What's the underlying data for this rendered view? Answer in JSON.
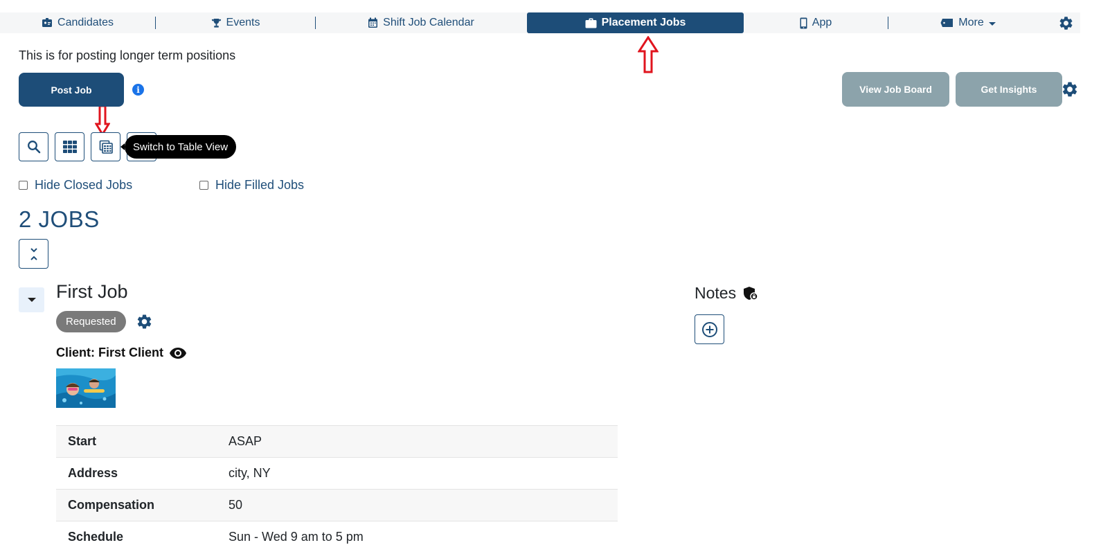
{
  "nav": {
    "items": [
      {
        "label": "Candidates",
        "icon": "id-badge-icon"
      },
      {
        "label": "Events",
        "icon": "trophy-icon"
      },
      {
        "label": "Shift Job Calendar",
        "icon": "calendar-icon"
      },
      {
        "label": "Placement Jobs",
        "icon": "briefcase-icon",
        "active": true
      },
      {
        "label": "App",
        "icon": "mobile-phone-icon"
      },
      {
        "label": "More",
        "icon": "ticket-icon"
      }
    ],
    "settings_icon": "gear-icon"
  },
  "header": {
    "subtitle": "This is for posting longer term positions",
    "post_job_label": "Post Job",
    "info_glyph": "i",
    "view_job_board_label": "View Job Board",
    "get_insights_label": "Get Insights"
  },
  "toolbar": {
    "tooltip": "Switch to Table View"
  },
  "filters": {
    "hide_closed": {
      "label": "Hide Closed Jobs",
      "checked": false
    },
    "hide_filled": {
      "label": "Hide Filled Jobs",
      "checked": false
    }
  },
  "jobs": {
    "count_label": "2 JOBS",
    "first": {
      "title": "First Job",
      "status": "Requested",
      "client": "Client: First Client",
      "details": [
        {
          "label": "Start",
          "value": "ASAP"
        },
        {
          "label": "Address",
          "value": "city, NY"
        },
        {
          "label": "Compensation",
          "value": "50"
        },
        {
          "label": "Schedule",
          "value": "Sun - Wed 9 am to 5 pm"
        }
      ]
    }
  },
  "notes": {
    "title": "Notes"
  },
  "colors": {
    "primary": "#1d4d78",
    "grey_button": "#8ca3ab",
    "annotation_red": "#e0141e",
    "badge": "#7a7a7a"
  }
}
